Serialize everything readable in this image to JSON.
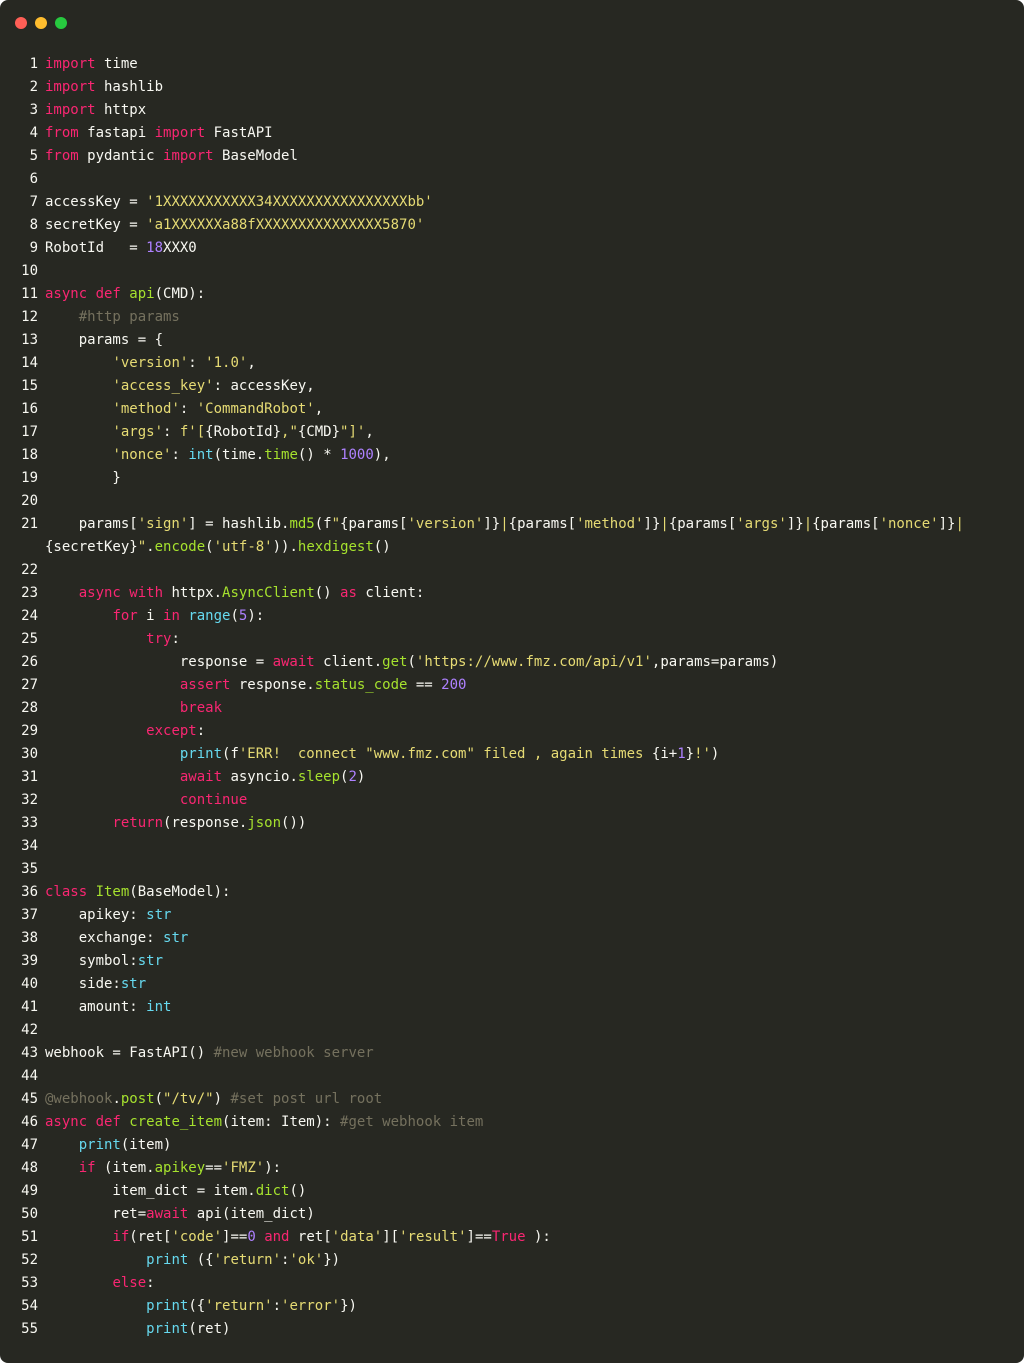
{
  "window": {
    "buttons": [
      "close",
      "minimize",
      "maximize"
    ],
    "colors": {
      "background": "#272822",
      "keyword": "#f92672",
      "string": "#e6db74",
      "function": "#a6e22e",
      "builtin": "#66d9ef",
      "number": "#ae81ff",
      "comment": "#75715e",
      "plain": "#f8f8f2"
    }
  },
  "lines": [
    {
      "n": "1",
      "t": [
        [
          "k",
          "import"
        ],
        [
          "p",
          " time"
        ]
      ]
    },
    {
      "n": "2",
      "t": [
        [
          "k",
          "import"
        ],
        [
          "p",
          " hashlib"
        ]
      ]
    },
    {
      "n": "3",
      "t": [
        [
          "k",
          "import"
        ],
        [
          "p",
          " httpx"
        ]
      ]
    },
    {
      "n": "4",
      "t": [
        [
          "k",
          "from"
        ],
        [
          "p",
          " fastapi "
        ],
        [
          "k",
          "import"
        ],
        [
          "p",
          " FastAPI"
        ]
      ]
    },
    {
      "n": "5",
      "t": [
        [
          "k",
          "from"
        ],
        [
          "p",
          " pydantic "
        ],
        [
          "k",
          "import"
        ],
        [
          "p",
          " BaseModel"
        ]
      ]
    },
    {
      "n": "6",
      "t": []
    },
    {
      "n": "7",
      "t": [
        [
          "p",
          "accessKey = "
        ],
        [
          "s",
          "'1XXXXXXXXXXX34XXXXXXXXXXXXXXXXbb'"
        ]
      ]
    },
    {
      "n": "8",
      "t": [
        [
          "p",
          "secretKey = "
        ],
        [
          "s",
          "'a1XXXXXXa88fXXXXXXXXXXXXXXX5870'"
        ]
      ]
    },
    {
      "n": "9",
      "t": [
        [
          "p",
          "RobotId   = "
        ],
        [
          "n",
          "18"
        ],
        [
          "p",
          "XXX0"
        ]
      ]
    },
    {
      "n": "10",
      "t": []
    },
    {
      "n": "11",
      "t": [
        [
          "k",
          "async def "
        ],
        [
          "f",
          "api"
        ],
        [
          "p",
          "(CMD):"
        ]
      ]
    },
    {
      "n": "12",
      "t": [
        [
          "p",
          "    "
        ],
        [
          "c",
          "#http params"
        ]
      ]
    },
    {
      "n": "13",
      "t": [
        [
          "p",
          "    params = {"
        ]
      ]
    },
    {
      "n": "14",
      "t": [
        [
          "p",
          "        "
        ],
        [
          "s",
          "'version'"
        ],
        [
          "p",
          ": "
        ],
        [
          "s",
          "'1.0'"
        ],
        [
          "p",
          ","
        ]
      ]
    },
    {
      "n": "15",
      "t": [
        [
          "p",
          "        "
        ],
        [
          "s",
          "'access_key'"
        ],
        [
          "p",
          ": accessKey,"
        ]
      ]
    },
    {
      "n": "16",
      "t": [
        [
          "p",
          "        "
        ],
        [
          "s",
          "'method'"
        ],
        [
          "p",
          ": "
        ],
        [
          "s",
          "'CommandRobot'"
        ],
        [
          "p",
          ","
        ]
      ]
    },
    {
      "n": "17",
      "t": [
        [
          "p",
          "        "
        ],
        [
          "s",
          "'args'"
        ],
        [
          "p",
          ": "
        ],
        [
          "s",
          "f'["
        ],
        [
          "p",
          "{RobotId}"
        ],
        [
          "s",
          ",\""
        ],
        [
          "p",
          "{CMD}"
        ],
        [
          "s",
          "\"]'"
        ],
        [
          "p",
          ","
        ]
      ]
    },
    {
      "n": "18",
      "t": [
        [
          "p",
          "        "
        ],
        [
          "s",
          "'nonce'"
        ],
        [
          "p",
          ": "
        ],
        [
          "b",
          "int"
        ],
        [
          "p",
          "(time."
        ],
        [
          "f",
          "time"
        ],
        [
          "p",
          "() * "
        ],
        [
          "n",
          "1000"
        ],
        [
          "p",
          "),"
        ]
      ]
    },
    {
      "n": "19",
      "t": [
        [
          "p",
          "        }"
        ]
      ]
    },
    {
      "n": "20",
      "t": []
    },
    {
      "n": "21",
      "t": [
        [
          "p",
          "    params["
        ],
        [
          "s",
          "'sign'"
        ],
        [
          "p",
          "] = hashlib."
        ],
        [
          "f",
          "md5"
        ],
        [
          "p",
          "(f"
        ],
        [
          "s",
          "\""
        ],
        [
          "p",
          "{params["
        ],
        [
          "s",
          "'version'"
        ],
        [
          "p",
          "]}"
        ],
        [
          "s",
          "|"
        ],
        [
          "p",
          "{params["
        ],
        [
          "s",
          "'method'"
        ],
        [
          "p",
          "]}"
        ],
        [
          "s",
          "|"
        ],
        [
          "p",
          "{params["
        ],
        [
          "s",
          "'args'"
        ],
        [
          "p",
          "]}"
        ],
        [
          "s",
          "|"
        ],
        [
          "p",
          "{params["
        ],
        [
          "s",
          "'nonce'"
        ],
        [
          "p",
          "]}"
        ],
        [
          "s",
          "|"
        ]
      ]
    },
    {
      "n": "",
      "t": [
        [
          "p",
          "{secretKey}"
        ],
        [
          "s",
          "\""
        ],
        [
          "p",
          "."
        ],
        [
          "f",
          "encode"
        ],
        [
          "p",
          "("
        ],
        [
          "s",
          "'utf-8'"
        ],
        [
          "p",
          "))."
        ],
        [
          "f",
          "hexdigest"
        ],
        [
          "p",
          "()"
        ]
      ]
    },
    {
      "n": "22",
      "t": []
    },
    {
      "n": "23",
      "t": [
        [
          "p",
          "    "
        ],
        [
          "k",
          "async with"
        ],
        [
          "p",
          " httpx."
        ],
        [
          "f",
          "AsyncClient"
        ],
        [
          "p",
          "() "
        ],
        [
          "k",
          "as"
        ],
        [
          "p",
          " client:"
        ]
      ]
    },
    {
      "n": "24",
      "t": [
        [
          "p",
          "        "
        ],
        [
          "k",
          "for"
        ],
        [
          "p",
          " i "
        ],
        [
          "k",
          "in"
        ],
        [
          "p",
          " "
        ],
        [
          "b",
          "range"
        ],
        [
          "p",
          "("
        ],
        [
          "n",
          "5"
        ],
        [
          "p",
          "):"
        ]
      ]
    },
    {
      "n": "25",
      "t": [
        [
          "p",
          "            "
        ],
        [
          "k",
          "try"
        ],
        [
          "p",
          ":"
        ]
      ]
    },
    {
      "n": "26",
      "t": [
        [
          "p",
          "                response = "
        ],
        [
          "k",
          "await"
        ],
        [
          "p",
          " client."
        ],
        [
          "f",
          "get"
        ],
        [
          "p",
          "("
        ],
        [
          "s",
          "'https://www.fmz.com/api/v1'"
        ],
        [
          "p",
          ",params=params)"
        ]
      ]
    },
    {
      "n": "27",
      "t": [
        [
          "p",
          "                "
        ],
        [
          "k",
          "assert"
        ],
        [
          "p",
          " response."
        ],
        [
          "f",
          "status_code"
        ],
        [
          "p",
          " == "
        ],
        [
          "n",
          "200"
        ]
      ]
    },
    {
      "n": "28",
      "t": [
        [
          "p",
          "                "
        ],
        [
          "k",
          "break"
        ]
      ]
    },
    {
      "n": "29",
      "t": [
        [
          "p",
          "            "
        ],
        [
          "k",
          "except"
        ],
        [
          "p",
          ":"
        ]
      ]
    },
    {
      "n": "30",
      "t": [
        [
          "p",
          "                "
        ],
        [
          "b",
          "print"
        ],
        [
          "p",
          "(f"
        ],
        [
          "s",
          "'ERR!  connect \"www.fmz.com\" filed , again times "
        ],
        [
          "p",
          "{i+"
        ],
        [
          "n",
          "1"
        ],
        [
          "p",
          "}"
        ],
        [
          "s",
          "!'"
        ],
        [
          "p",
          ")"
        ]
      ]
    },
    {
      "n": "31",
      "t": [
        [
          "p",
          "                "
        ],
        [
          "k",
          "await"
        ],
        [
          "p",
          " asyncio."
        ],
        [
          "f",
          "sleep"
        ],
        [
          "p",
          "("
        ],
        [
          "n",
          "2"
        ],
        [
          "p",
          ")"
        ]
      ]
    },
    {
      "n": "32",
      "t": [
        [
          "p",
          "                "
        ],
        [
          "k",
          "continue"
        ]
      ]
    },
    {
      "n": "33",
      "t": [
        [
          "p",
          "        "
        ],
        [
          "k",
          "return"
        ],
        [
          "p",
          "(response."
        ],
        [
          "f",
          "json"
        ],
        [
          "p",
          "())"
        ]
      ]
    },
    {
      "n": "34",
      "t": []
    },
    {
      "n": "35",
      "t": []
    },
    {
      "n": "36",
      "t": [
        [
          "k",
          "class "
        ],
        [
          "f",
          "Item"
        ],
        [
          "p",
          "(BaseModel):"
        ]
      ]
    },
    {
      "n": "37",
      "t": [
        [
          "p",
          "    apikey: "
        ],
        [
          "b",
          "str"
        ]
      ]
    },
    {
      "n": "38",
      "t": [
        [
          "p",
          "    exchange: "
        ],
        [
          "b",
          "str"
        ]
      ]
    },
    {
      "n": "39",
      "t": [
        [
          "p",
          "    symbol:"
        ],
        [
          "b",
          "str"
        ]
      ]
    },
    {
      "n": "40",
      "t": [
        [
          "p",
          "    side:"
        ],
        [
          "b",
          "str"
        ]
      ]
    },
    {
      "n": "41",
      "t": [
        [
          "p",
          "    amount: "
        ],
        [
          "b",
          "int"
        ]
      ]
    },
    {
      "n": "42",
      "t": []
    },
    {
      "n": "43",
      "t": [
        [
          "p",
          "webhook = FastAPI() "
        ],
        [
          "c",
          "#new webhook server"
        ]
      ]
    },
    {
      "n": "44",
      "t": []
    },
    {
      "n": "45",
      "t": [
        [
          "c",
          "@webhook"
        ],
        [
          "p",
          "."
        ],
        [
          "f",
          "post"
        ],
        [
          "p",
          "("
        ],
        [
          "s",
          "\"/tv/\""
        ],
        [
          "p",
          ") "
        ],
        [
          "c",
          "#set post url root"
        ]
      ]
    },
    {
      "n": "46",
      "t": [
        [
          "k",
          "async def "
        ],
        [
          "f",
          "create_item"
        ],
        [
          "p",
          "(item: Item): "
        ],
        [
          "c",
          "#get webhook item"
        ]
      ]
    },
    {
      "n": "47",
      "t": [
        [
          "p",
          "    "
        ],
        [
          "b",
          "print"
        ],
        [
          "p",
          "(item)"
        ]
      ]
    },
    {
      "n": "48",
      "t": [
        [
          "p",
          "    "
        ],
        [
          "k",
          "if"
        ],
        [
          "p",
          " (item."
        ],
        [
          "f",
          "apikey"
        ],
        [
          "p",
          "=="
        ],
        [
          "s",
          "'FMZ'"
        ],
        [
          "p",
          "):"
        ]
      ]
    },
    {
      "n": "49",
      "t": [
        [
          "p",
          "        item_dict = item."
        ],
        [
          "f",
          "dict"
        ],
        [
          "p",
          "()"
        ]
      ]
    },
    {
      "n": "50",
      "t": [
        [
          "p",
          "        ret="
        ],
        [
          "k",
          "await"
        ],
        [
          "p",
          " api(item_dict)"
        ]
      ]
    },
    {
      "n": "51",
      "t": [
        [
          "p",
          "        "
        ],
        [
          "k",
          "if"
        ],
        [
          "p",
          "(ret["
        ],
        [
          "s",
          "'code'"
        ],
        [
          "p",
          "]=="
        ],
        [
          "n",
          "0"
        ],
        [
          "p",
          " "
        ],
        [
          "k",
          "and"
        ],
        [
          "p",
          " ret["
        ],
        [
          "s",
          "'data'"
        ],
        [
          "p",
          "]["
        ],
        [
          "s",
          "'result'"
        ],
        [
          "p",
          "]=="
        ],
        [
          "k",
          "True"
        ],
        [
          "p",
          " ):"
        ]
      ]
    },
    {
      "n": "52",
      "t": [
        [
          "p",
          "            "
        ],
        [
          "b",
          "print"
        ],
        [
          "p",
          " ({"
        ],
        [
          "s",
          "'return'"
        ],
        [
          "p",
          ":"
        ],
        [
          "s",
          "'ok'"
        ],
        [
          "p",
          "})"
        ]
      ]
    },
    {
      "n": "53",
      "t": [
        [
          "p",
          "        "
        ],
        [
          "k",
          "else"
        ],
        [
          "p",
          ":"
        ]
      ]
    },
    {
      "n": "54",
      "t": [
        [
          "p",
          "            "
        ],
        [
          "b",
          "print"
        ],
        [
          "p",
          "({"
        ],
        [
          "s",
          "'return'"
        ],
        [
          "p",
          ":"
        ],
        [
          "s",
          "'error'"
        ],
        [
          "p",
          "})"
        ]
      ]
    },
    {
      "n": "55",
      "t": [
        [
          "p",
          "            "
        ],
        [
          "b",
          "print"
        ],
        [
          "p",
          "(ret)"
        ]
      ]
    }
  ]
}
